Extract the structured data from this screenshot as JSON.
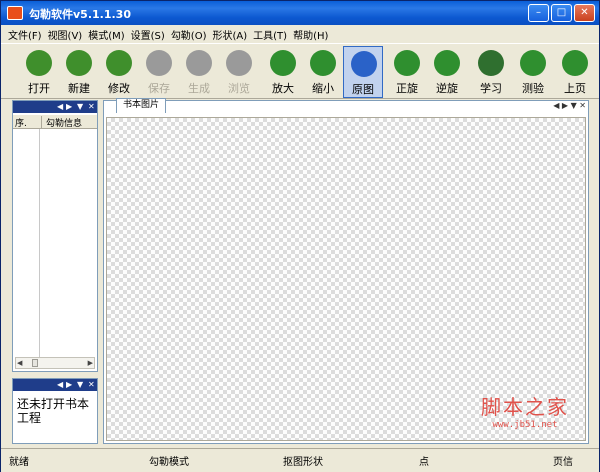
{
  "window": {
    "title": "勾勒软件v5.1.1.30",
    "minimize": "–",
    "maximize": "□",
    "close": "✕"
  },
  "menu": [
    "文件(F)",
    "视图(V)",
    "模式(M)",
    "设置(S)",
    "勾勒(O)",
    "形状(A)",
    "工具(T)",
    "帮助(H)"
  ],
  "toolbar": [
    {
      "label": "打开",
      "icon": "open-folder-icon",
      "color": "#3f8f2c"
    },
    {
      "label": "新建",
      "icon": "new-doc-icon",
      "color": "#3f8f2c"
    },
    {
      "label": "修改",
      "icon": "edit-refresh-icon",
      "color": "#3f8f2c"
    },
    {
      "label": "保存",
      "icon": "save-disk-icon",
      "color": "#9a9a9a"
    },
    {
      "label": "生成",
      "icon": "play-icon",
      "color": "#9a9a9a"
    },
    {
      "label": "浏览",
      "icon": "preview-icon",
      "color": "#9a9a9a"
    },
    {
      "label": "放大",
      "icon": "zoom-in-icon",
      "color": "#2f8f2f"
    },
    {
      "label": "缩小",
      "icon": "zoom-out-icon",
      "color": "#2f8f2f"
    },
    {
      "label": "原图",
      "icon": "magnifier-icon",
      "color": "#2a62c8"
    },
    {
      "label": "正旋",
      "icon": "rotate-right-icon",
      "color": "#2f8f2f"
    },
    {
      "label": "逆旋",
      "icon": "rotate-left-icon",
      "color": "#2f8f2f"
    },
    {
      "label": "学习",
      "icon": "study-icon",
      "color": "#2f6f2f"
    },
    {
      "label": "测验",
      "icon": "users-icon",
      "color": "#2f8f2f"
    },
    {
      "label": "上页",
      "icon": "arrow-left-icon",
      "color": "#2f8f2f"
    }
  ],
  "left_panel": {
    "columns": [
      "序.",
      "勾勒信息"
    ]
  },
  "bottom_panel": {
    "note": "还未打开书本工程"
  },
  "document": {
    "tab": "书本图片"
  },
  "watermark": {
    "big": "脚本之家",
    "small": "www.jb51.net"
  },
  "status": [
    "就绪",
    "勾勒模式",
    "抠图形状",
    "点",
    "页信"
  ]
}
